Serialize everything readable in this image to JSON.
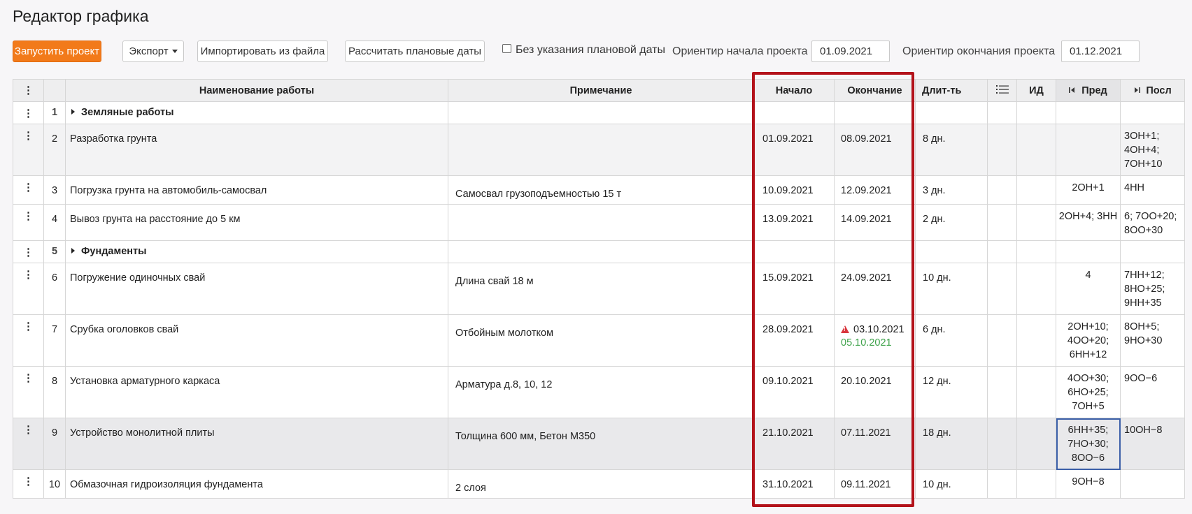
{
  "page": {
    "title": "Редактор графика"
  },
  "toolbar": {
    "run_project": "Запустить проект",
    "export": "Экспорт",
    "import": "Импортировать из файла",
    "calc_dates": "Рассчитать плановые даты",
    "no_plan_date_label": "Без указания плановой даты",
    "no_plan_date_checked": false,
    "start_label": "Ориентир начала проекта",
    "start_value": "01.09.2021",
    "end_label": "Ориентир окончания проекта",
    "end_value": "01.12.2021",
    "accent_color": "#f27a1a"
  },
  "grid": {
    "headers": {
      "menu": "⋮",
      "name": "Наименование работы",
      "note": "Примечание",
      "start": "Начало",
      "end": "Окончание",
      "duration": "Длит-ть",
      "list_icon": "list-icon",
      "id": "ИД",
      "pred": "Пред",
      "post": "Посл"
    },
    "rows": [
      {
        "num": "1",
        "group": true,
        "name": "Земляные работы",
        "note": "",
        "start": "",
        "end": "",
        "duration": "",
        "pred": "",
        "post": ""
      },
      {
        "num": "2",
        "name": "Разработка грунта",
        "note": "",
        "start": "01.09.2021",
        "end": "08.09.2021",
        "duration": "8 дн.",
        "pred": "",
        "post_lines": [
          "3ОН+1;",
          "4ОН+4;",
          "7ОН+10"
        ]
      },
      {
        "num": "3",
        "name": "Погрузка грунта на автомобиль-самосвал",
        "note": "Самосвал грузоподъемностью 15 т",
        "start": "10.09.2021",
        "end": "12.09.2021",
        "duration": "3 дн.",
        "pred_lines": [
          "2ОН+1"
        ],
        "post_lines": [
          "4НН"
        ]
      },
      {
        "num": "4",
        "name": "Вывоз грунта на расстояние до 5 км",
        "note": "",
        "start": "13.09.2021",
        "end": "14.09.2021",
        "duration": "2 дн.",
        "pred_lines": [
          "2ОН+4; 3НН"
        ],
        "post_lines": [
          "6; 7ОО+20;",
          "8ОО+30"
        ]
      },
      {
        "num": "5",
        "group": true,
        "name": "Фундаменты",
        "note": "",
        "start": "",
        "end": "",
        "duration": "",
        "pred": "",
        "post": ""
      },
      {
        "num": "6",
        "name": "Погружение одиночных свай",
        "note": "Длина свай 18 м",
        "start": "15.09.2021",
        "end": "24.09.2021",
        "duration": "10 дн.",
        "pred_lines": [
          "4"
        ],
        "post_lines": [
          "7НН+12;",
          "8НО+25;",
          "9НН+35"
        ]
      },
      {
        "num": "7",
        "name": "Срубка оголовков свай",
        "note": "Отбойным молотком",
        "start": "28.09.2021",
        "end": "03.10.2021",
        "end_warning": true,
        "end_new": "05.10.2021",
        "duration": "6 дн.",
        "pred_lines": [
          "2ОН+10;",
          "4ОО+20;",
          "6НН+12"
        ],
        "post_lines": [
          "8ОН+5;",
          "9НО+30"
        ]
      },
      {
        "num": "8",
        "name": "Установка арматурного каркаса",
        "note": "Арматура д.8, 10, 12",
        "start": "09.10.2021",
        "end": "20.10.2021",
        "duration": "12 дн.",
        "pred_lines": [
          "4ОО+30;",
          "6НО+25;",
          "7ОН+5"
        ],
        "post_lines": [
          "9ОО−6"
        ]
      },
      {
        "num": "9",
        "name": "Устройство монолитной плиты",
        "note": "Толщина 600 мм, Бетон М350",
        "start": "21.10.2021",
        "end": "07.11.2021",
        "duration": "18 дн.",
        "pred_lines": [
          "6НН+35;",
          "7НО+30;",
          "8ОО−6"
        ],
        "post_lines": [
          "10ОН−8"
        ],
        "selected": true
      },
      {
        "num": "10",
        "name": "Обмазочная гидроизоляция фундамента",
        "note": "2 слоя",
        "start": "31.10.2021",
        "end": "09.11.2021",
        "duration": "10 дн.",
        "pred_lines": [
          "9ОН−8"
        ],
        "post_lines": []
      }
    ]
  },
  "highlight_color": "#b3121a",
  "warning_icon": "warning-triangle-icon",
  "new_date_color": "#3ea24a",
  "link_color": "#3d63b0"
}
